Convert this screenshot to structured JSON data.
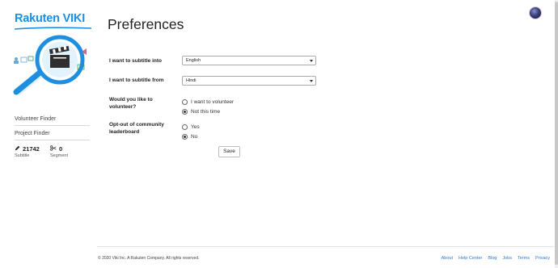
{
  "brand": {
    "logo_text": "Rakuten VIKI"
  },
  "page": {
    "title": "Preferences"
  },
  "sidebar": {
    "links": [
      {
        "label": "Volunteer Finder"
      },
      {
        "label": "Project Finder"
      }
    ],
    "stats": [
      {
        "value": "21742",
        "label": "Subtitle",
        "icon": "pencil-icon"
      },
      {
        "value": "0",
        "label": "Segment",
        "icon": "scissors-icon"
      }
    ]
  },
  "form": {
    "subtitle_into": {
      "question": "I want to subtitle into",
      "value": "English"
    },
    "subtitle_from": {
      "question": "I want to subtitle from",
      "value": "Hindi"
    },
    "volunteer": {
      "question": "Would you like to volunteer?",
      "options": [
        {
          "label": "I want to volunteer",
          "selected": false
        },
        {
          "label": "Not this time",
          "selected": true
        }
      ]
    },
    "leaderboard": {
      "question": "Opt-out of community leaderboard",
      "options": [
        {
          "label": "Yes",
          "selected": false
        },
        {
          "label": "No",
          "selected": true
        }
      ]
    },
    "save_label": "Save"
  },
  "footer": {
    "copyright": "© 2020 Viki Inc. A Rakuten Company. All rights reserved.",
    "links": [
      "About",
      "Help Center",
      "Blog",
      "Jobs",
      "Terms",
      "Privacy"
    ]
  },
  "colors": {
    "brand": "#1a8fe3",
    "link": "#2a7dd1"
  }
}
